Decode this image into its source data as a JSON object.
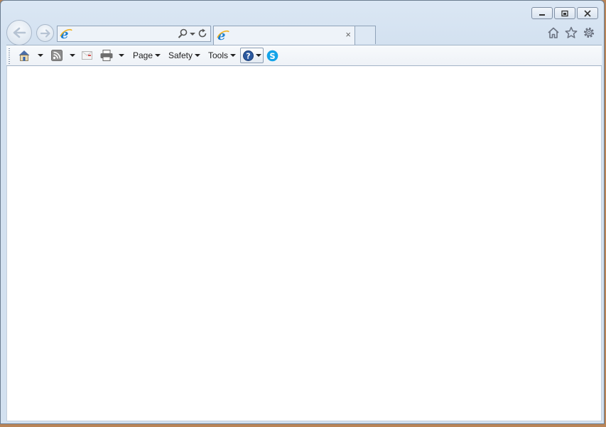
{
  "window": {
    "minimize_icon": "minimize-icon",
    "restore_icon": "restore-icon",
    "close_icon": "close-icon"
  },
  "nav": {
    "back_icon": "back-arrow-icon",
    "forward_icon": "forward-arrow-icon"
  },
  "address_bar": {
    "value": "",
    "placeholder": "",
    "icons": [
      "ie-logo-icon",
      "search-icon",
      "dropdown-icon",
      "refresh-icon"
    ]
  },
  "tabs": [
    {
      "title": "",
      "icon": "ie-logo-icon",
      "close_label": "×"
    }
  ],
  "toolbar_right": [
    "home-icon",
    "favorites-star-icon",
    "settings-gear-icon"
  ],
  "command_bar": {
    "page_label": "Page",
    "safety_label": "Safety",
    "tools_label": "Tools",
    "icons": [
      "home-icon",
      "rss-feed-icon",
      "read-mail-icon",
      "print-icon",
      "help-icon",
      "skype-icon"
    ]
  },
  "colors": {
    "frame": "#d3e1f0",
    "ie_blue": "#1b7fd3",
    "skype_blue": "#13a3e8",
    "help_blue": "#2c5aa0"
  }
}
